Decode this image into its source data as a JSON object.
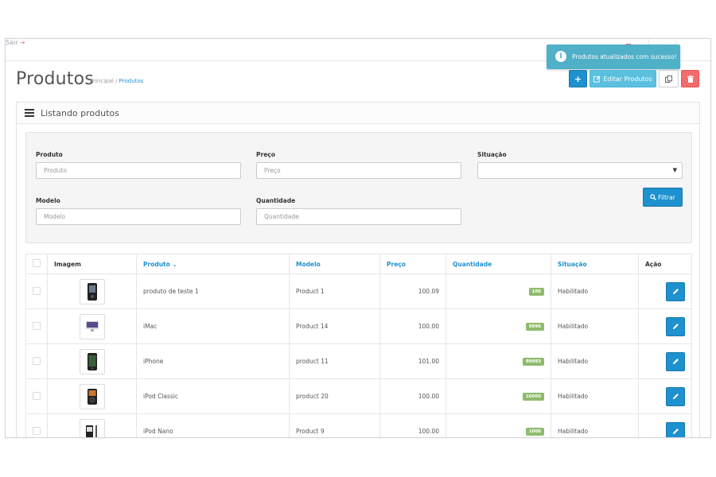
{
  "header": {
    "title": "Produtos",
    "breadcrumb": [
      {
        "label": "Principal"
      },
      {
        "label": "Produtos"
      }
    ],
    "edit_button_label": "Editar Produtos",
    "exit_label": "Sair"
  },
  "toast": {
    "message": "Produtos atualizados com sucesso!"
  },
  "panel": {
    "heading": "Listando produtos"
  },
  "filter": {
    "produto_label": "Produto",
    "produto_placeholder": "Produto",
    "preco_label": "Preço",
    "preco_placeholder": "Preço",
    "situacao_label": "Situação",
    "situacao_value": "",
    "modelo_label": "Modelo",
    "modelo_placeholder": "Modelo",
    "quantidade_label": "Quantidade",
    "quantidade_placeholder": "Quantidade",
    "filter_button_label": "Filtrar"
  },
  "table": {
    "columns": {
      "imagem": "Imagem",
      "produto": "Produto",
      "modelo": "Modelo",
      "preco": "Preço",
      "quantidade": "Quantidade",
      "situacao": "Situação",
      "acao": "Ação"
    },
    "rows": [
      {
        "produto": "produto de teste 1",
        "modelo": "Product 1",
        "preco": "100.09",
        "quantidade": "100",
        "situacao": "Habilitado"
      },
      {
        "produto": "iMac",
        "modelo": "Product 14",
        "preco": "100.00",
        "quantidade": "9996",
        "situacao": "Habilitado"
      },
      {
        "produto": "iPhone",
        "modelo": "product 11",
        "preco": "101.00",
        "quantidade": "99993",
        "situacao": "Habilitado"
      },
      {
        "produto": "iPod Classic",
        "modelo": "product 20",
        "preco": "100.00",
        "quantidade": "10000",
        "situacao": "Habilitado"
      },
      {
        "produto": "iPod Nano",
        "modelo": "Product 9",
        "preco": "100.00",
        "quantidade": "1000",
        "situacao": "Habilitado"
      }
    ]
  },
  "colors": {
    "primary": "#1e91cf",
    "info": "#5bc0de",
    "danger": "#f56b6b",
    "success_badge": "#8fbb6c",
    "toast": "#4fb0c8"
  },
  "icons": {
    "add": "plus-icon",
    "edit": "pencil-icon",
    "copy": "copy-icon",
    "delete": "trash-icon",
    "list": "list-icon",
    "filter": "search-icon",
    "toast": "info-icon",
    "sort": "chevron-down-icon"
  }
}
